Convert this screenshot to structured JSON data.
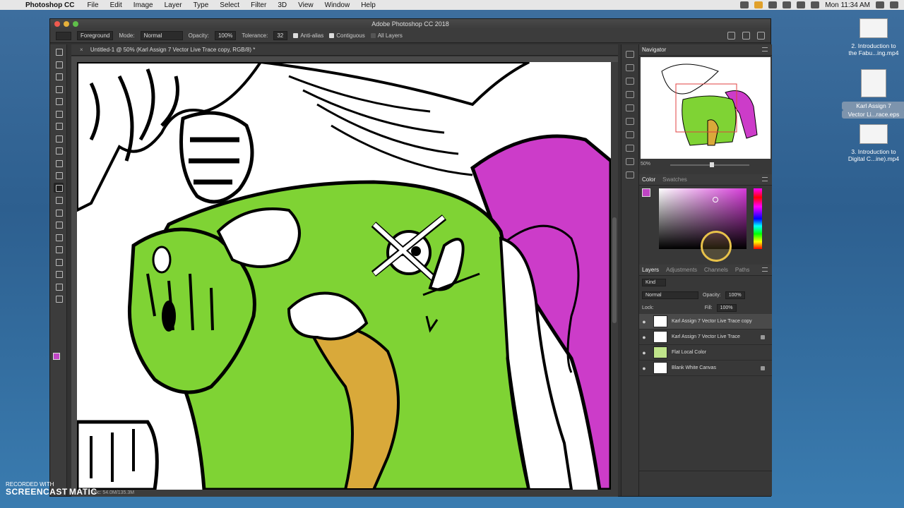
{
  "menubar": {
    "app": "Photoshop CC",
    "items": [
      "File",
      "Edit",
      "Image",
      "Layer",
      "Type",
      "Select",
      "Filter",
      "3D",
      "View",
      "Window",
      "Help"
    ],
    "clock": "Mon 11:34 AM"
  },
  "desktop": {
    "files": [
      {
        "name_line1": "2. Introduction to",
        "name_line2": "the Fabu...ing.mp4"
      },
      {
        "name_line1": "Karl Assign 7",
        "name_line2": "Vector Li...race.eps"
      },
      {
        "name_line1": "3. Introduction to",
        "name_line2": "Digital C...ine).mp4"
      }
    ]
  },
  "watermark": {
    "line1": "RECORDED WITH",
    "line2": "SCREENCAST",
    "line3": "MATIC"
  },
  "window": {
    "title": "Adobe Photoshop CC 2018"
  },
  "options": {
    "fill_source": "Foreground",
    "mode_label": "Mode:",
    "mode_value": "Normal",
    "opacity_label": "Opacity:",
    "opacity_value": "100%",
    "tolerance_label": "Tolerance:",
    "tolerance_value": "32",
    "antialias": "Anti-alias",
    "contiguous": "Contiguous",
    "all_layers": "All Layers"
  },
  "document": {
    "tab_title": "Untitled-1 @ 50% (Karl Assign 7 Vector Live Trace copy, RGB/8) *",
    "status": "Doc: 54.0M/135.3M"
  },
  "navigator": {
    "title": "Navigator",
    "zoom": "50%"
  },
  "color_panel": {
    "tab_color": "Color",
    "tab_swatches": "Swatches",
    "foreground": "#c045c5"
  },
  "layers_panel": {
    "tabs": [
      "Layers",
      "Adjustments",
      "Channels",
      "Paths"
    ],
    "kind": "Kind",
    "blend": "Normal",
    "opacity_label": "Opacity:",
    "opacity_value": "100%",
    "lock_label": "Lock:",
    "fill_label": "Fill:",
    "fill_value": "100%",
    "layers": [
      {
        "name": "Karl Assign 7 Vector Live Trace copy"
      },
      {
        "name": "Karl Assign 7 Vector Live Trace"
      },
      {
        "name": "Flat Local Color"
      },
      {
        "name": "Blank White Canvas"
      }
    ]
  },
  "colors": {
    "green": "#7fd334",
    "magenta": "#cc3cc9",
    "ochre": "#d9a93a"
  }
}
